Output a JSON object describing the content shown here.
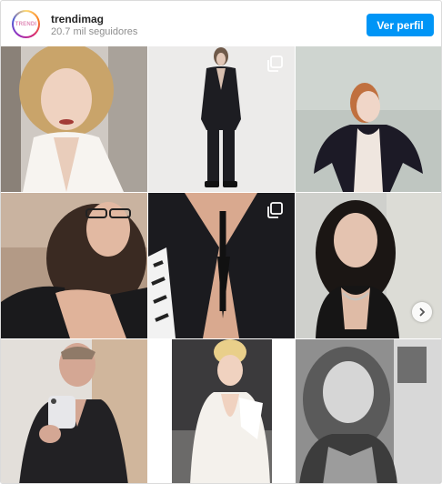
{
  "profile": {
    "avatar_text": "TRENDI",
    "username": "trendimag",
    "followers": "20.7 mil seguidores",
    "follow_label": "Ver perfil"
  },
  "colors": {
    "accent": "#0095f6",
    "username": "#262626",
    "secondary_text": "#8e8e8e",
    "border": "#dbdbdb"
  },
  "icons": {
    "multi_post": "multiple-photos-icon",
    "next": "chevron-right-icon"
  }
}
